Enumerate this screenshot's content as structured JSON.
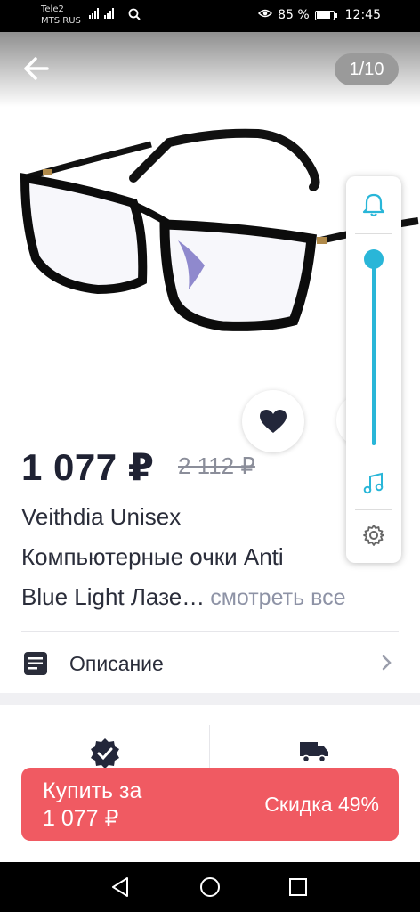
{
  "status_bar": {
    "carrier_1": "Tele2",
    "carrier_2": "MTS RUS",
    "battery_percent": "85 %",
    "time": "12:45"
  },
  "header": {
    "image_counter": "1/10"
  },
  "product": {
    "price": "1 077 ₽",
    "old_price": "2 112 ₽",
    "title_line_1": "Veithdia Unisex",
    "title_line_2": "Компьютерные очки Anti",
    "title_line_3": "Blue Light Лазе…",
    "see_all": "смотреть все"
  },
  "description": {
    "label": "Описание"
  },
  "buy_button": {
    "label_line_1": "Купить за",
    "label_line_2": "1 077 ₽",
    "discount": "Скидка 49%"
  },
  "side_panel": {
    "volume_level": 1.0
  },
  "colors": {
    "accent_red": "#f05a62",
    "slider_blue": "#29b6d8",
    "text_dark": "#1f2233",
    "text_muted": "#8e93a6"
  }
}
